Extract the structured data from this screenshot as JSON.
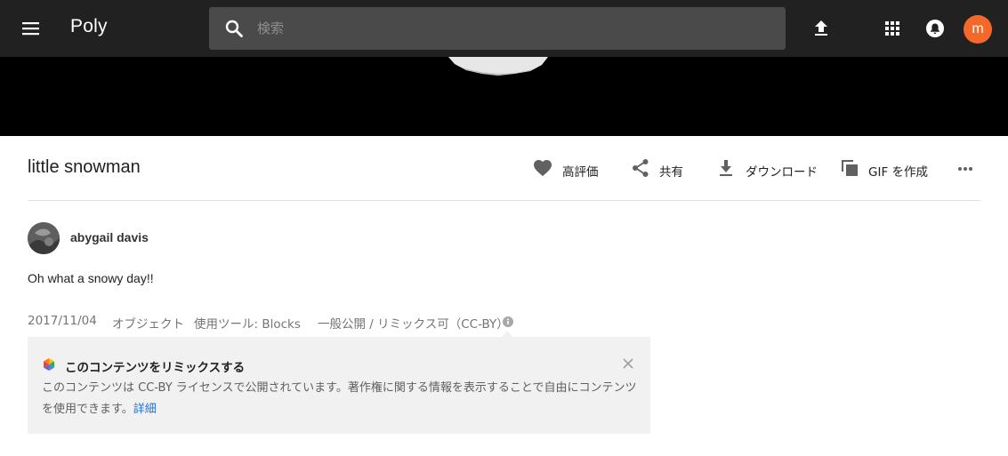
{
  "app": {
    "title": "Poly"
  },
  "search": {
    "placeholder": "検索"
  },
  "account": {
    "avatar_initial": "m",
    "avatar_color": "#f4692a"
  },
  "asset": {
    "title": "little snowman",
    "actions": {
      "like": "高評価",
      "share": "共有",
      "download": "ダウンロード",
      "gif": "GIF を作成"
    },
    "author": "abygail davis",
    "description": "Oh what a snowy day!!",
    "meta": {
      "date": "2017/11/04",
      "type": "オブジェクト",
      "tool": "使用ツール: Blocks",
      "license": "一般公開 / リミックス可（CC-BY）"
    }
  },
  "remix_notice": {
    "title": "このコンテンツをリミックスする",
    "body": "このコンテンツは CC-BY ライセンスで公開されています。著作権に関する情報を表示することで自由にコンテンツを使用できます。",
    "link": "詳細"
  },
  "colors": {
    "appbar": "#212121",
    "viewer_background": "#000000",
    "link": "#1a73e8"
  }
}
